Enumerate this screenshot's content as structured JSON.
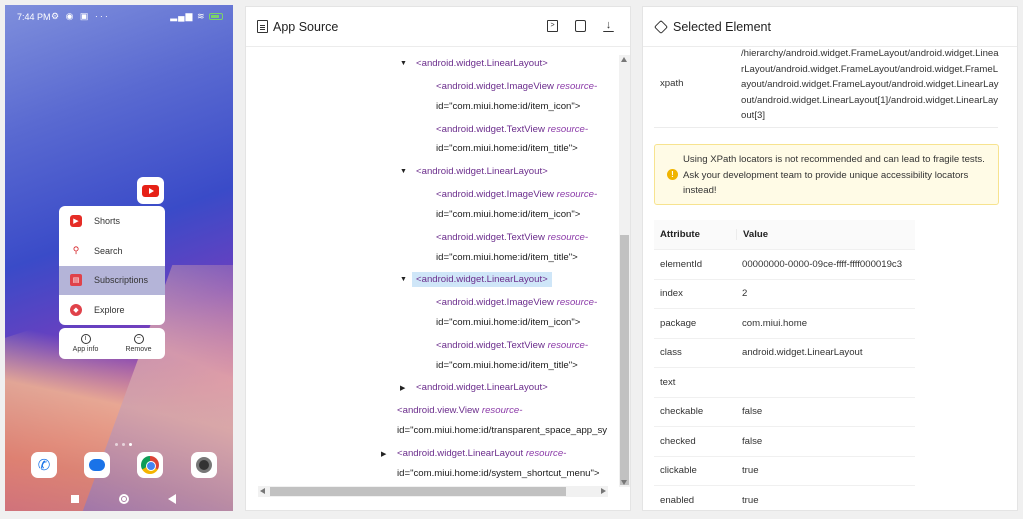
{
  "phone": {
    "time": "7:44 PM",
    "status_left_icons": "⚙ ◉ ▣ ···",
    "status_right_icons": "▂▄▆ ≋",
    "menu": [
      {
        "label": "Shorts",
        "icon": "shorts-icon",
        "selected": false
      },
      {
        "label": "Search",
        "icon": "search-icon",
        "selected": false
      },
      {
        "label": "Subscriptions",
        "icon": "subscriptions-icon",
        "selected": true
      },
      {
        "label": "Explore",
        "icon": "explore-icon",
        "selected": false
      }
    ],
    "app_info_label": "App info",
    "remove_label": "Remove",
    "dock": [
      "phone-app-icon",
      "messages-app-icon",
      "chrome-app-icon",
      "camera-app-icon"
    ]
  },
  "source": {
    "title": "App Source",
    "tree": [
      {
        "tag": "<android.widget.LinearLayout>",
        "caret": "expanded"
      },
      {
        "tag": "<android.widget.ImageView",
        "attr": "resource-",
        "cont": "id=\"com.miui.home:id/item_icon\">"
      },
      {
        "tag": "<android.widget.TextView",
        "attr": "resource-",
        "cont": "id=\"com.miui.home:id/item_title\">"
      },
      {
        "tag": "<android.widget.LinearLayout>",
        "caret": "expanded"
      },
      {
        "tag": "<android.widget.ImageView",
        "attr": "resource-",
        "cont": "id=\"com.miui.home:id/item_icon\">"
      },
      {
        "tag": "<android.widget.TextView",
        "attr": "resource-",
        "cont": "id=\"com.miui.home:id/item_title\">"
      },
      {
        "tag": "<android.widget.LinearLayout>",
        "caret": "expanded",
        "highlighted": true
      },
      {
        "tag": "<android.widget.ImageView",
        "attr": "resource-",
        "cont": "id=\"com.miui.home:id/item_icon\">"
      },
      {
        "tag": "<android.widget.TextView",
        "attr": "resource-",
        "cont": "id=\"com.miui.home:id/item_title\">"
      },
      {
        "tag": "<android.widget.LinearLayout>",
        "caret": "collapsed"
      },
      {
        "tag": "<android.view.View",
        "attr": "resource-",
        "cont": "id=\"com.miui.home:id/transparent_space_app_sy"
      },
      {
        "tag": "<android.widget.LinearLayout",
        "attr": "resource-",
        "cont": "id=\"com.miui.home:id/system_shortcut_menu\">",
        "caret": "collapsed"
      }
    ]
  },
  "selected": {
    "title": "Selected Element",
    "xpath_key": "xpath",
    "xpath_value": "/hierarchy/android.widget.FrameLayout/android.widget.LinearLayout/android.widget.FrameLayout/android.widget.FrameLayout/android.widget.FrameLayout/android.widget.LinearLayout/android.widget.LinearLayout[1]/android.widget.LinearLayout[3]",
    "warning": "Using XPath locators is not recommended and can lead to fragile tests. Ask your development team to provide unique accessibility locators instead!",
    "attr_header": "Attribute",
    "value_header": "Value",
    "attributes": [
      {
        "k": "elementId",
        "v": "00000000-0000-09ce-ffff-ffff000019c3"
      },
      {
        "k": "index",
        "v": "2"
      },
      {
        "k": "package",
        "v": "com.miui.home"
      },
      {
        "k": "class",
        "v": "android.widget.LinearLayout"
      },
      {
        "k": "text",
        "v": ""
      },
      {
        "k": "checkable",
        "v": "false"
      },
      {
        "k": "checked",
        "v": "false"
      },
      {
        "k": "clickable",
        "v": "true"
      },
      {
        "k": "enabled",
        "v": "true"
      }
    ]
  }
}
